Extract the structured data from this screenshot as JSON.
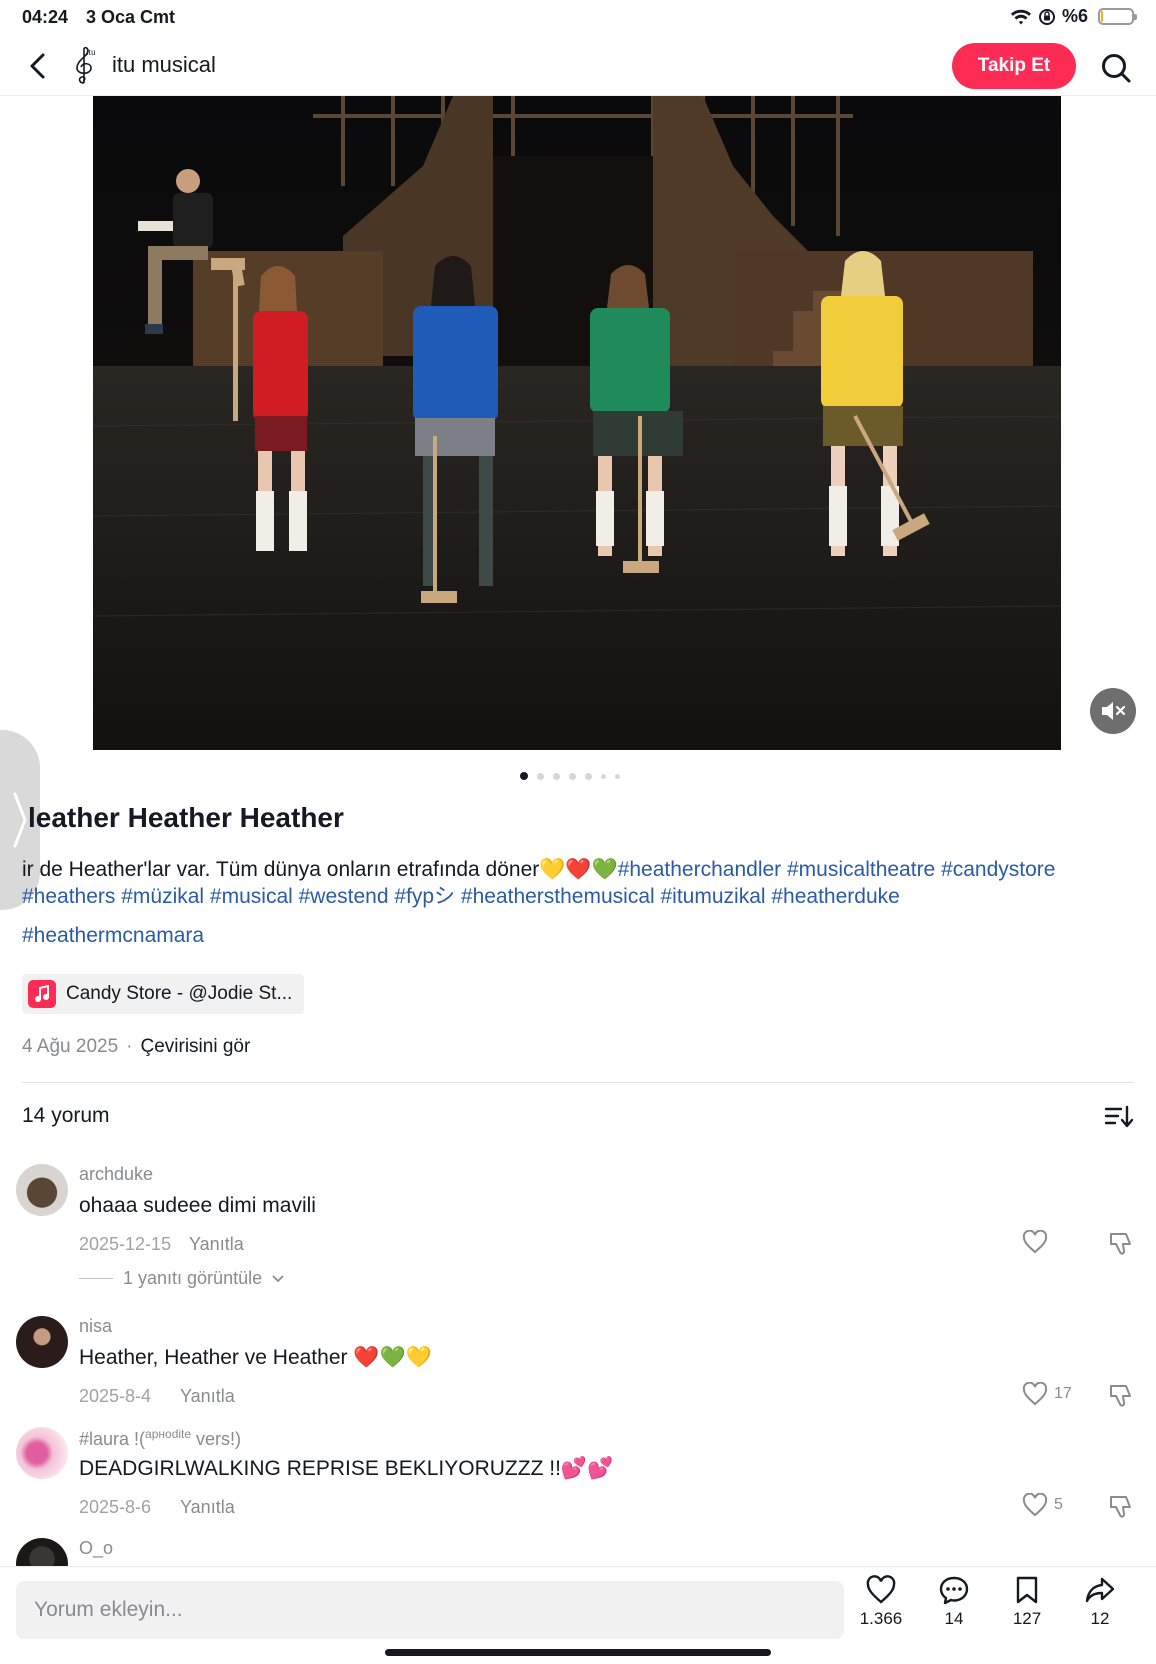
{
  "status_bar": {
    "time": "04:24",
    "date": "3 Oca Cmt",
    "battery_text": "%6",
    "battery_level": 0.06,
    "icons": [
      "wifi-icon",
      "orientation-lock-icon",
      "battery-icon"
    ]
  },
  "nav": {
    "title": "itu musical",
    "follow_label": "Takip Et",
    "icons": [
      "back-arrow-icon",
      "search-icon"
    ]
  },
  "media": {
    "page_count": 7,
    "active_index": 0
  },
  "post": {
    "title": "leather Heather Heather",
    "caption_text": "ir de Heather'lar var. Tüm dünya onların etrafında döner💛❤️💚",
    "caption_tags_line1": "#heatherchandler #musicaltheatre #candystore",
    "caption_tags_line2": "#heathers #müzikal #musical #westend #fypシ #heathersthemusical #itumuzikal #heatherduke",
    "caption_tags_line3": "#heathermcnamara",
    "music_label": "Candy Store - @Jodie St...",
    "date": "4 Ağu 2025",
    "translate_label": "Çevirisini gör"
  },
  "comments_section": {
    "header": "14 yorum",
    "items": [
      {
        "user": "archduke",
        "text": "ohaaa sudeee dimi mavili",
        "date": "2025-12-15",
        "reply_label": "Yanıtla",
        "likes": "",
        "view_replies": "1 yanıtı görüntüle"
      },
      {
        "user": "nisa",
        "text": "Heather, Heather ve Heather ❤️💚💛",
        "date": "2025-8-4",
        "reply_label": "Yanıtla",
        "likes": "17"
      },
      {
        "user": "#laura !(",
        "user_sup": "apнodite",
        "user_tail": " vers!)",
        "text": "DEADGIRLWALKING REPRISE BEKLIYORUZZZ !!💕💕",
        "date": "2025-8-6",
        "reply_label": "Yanıtla",
        "likes": "5"
      },
      {
        "user": "O_o"
      }
    ]
  },
  "bottom_bar": {
    "input_placeholder": "Yorum ekleyin...",
    "likes": "1.366",
    "comments": "14",
    "saves": "127",
    "shares": "12"
  },
  "colors": {
    "accent": "#fe2c55",
    "hashtag": "#2b5aa8",
    "muted": "#8a8b91",
    "text": "#161823"
  }
}
